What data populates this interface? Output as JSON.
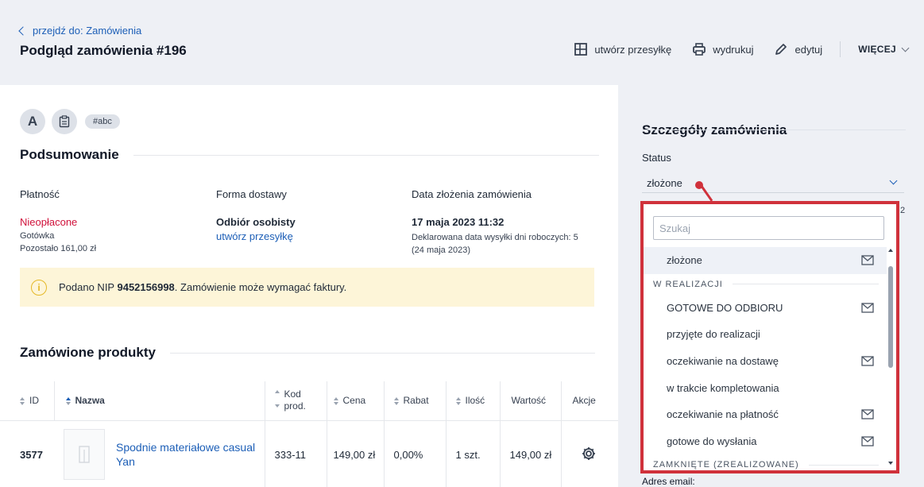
{
  "header": {
    "back_link": "przejdź do: Zamówienia",
    "title": "Podgląd zamówienia #196",
    "actions": {
      "shipment": "utwórz przesyłkę",
      "print": "wydrukuj",
      "edit": "edytuj",
      "more": "WIĘCEJ"
    }
  },
  "chips": {
    "avatar_letter": "A",
    "tag": "#abc"
  },
  "summary": {
    "heading": "Podsumowanie",
    "payment": {
      "label": "Płatność",
      "status": "Nieopłacone",
      "method": "Gotówka",
      "remaining": "Pozostało 161,00 zł"
    },
    "delivery": {
      "label": "Forma dostawy",
      "method": "Odbiór osobisty",
      "link": "utwórz przesyłkę"
    },
    "date": {
      "label": "Data złożenia zamówienia",
      "value": "17 maja 2023 11:32",
      "note_line1": "Deklarowana data wysyłki dni roboczych: 5",
      "note_line2": "(24 maja 2023)"
    },
    "alert": {
      "prefix": "Podano NIP ",
      "nip": "9452156998",
      "suffix": ". Zamówienie może wymagać faktury."
    }
  },
  "products": {
    "heading": "Zamówione produkty",
    "columns": {
      "id": "ID",
      "name": "Nazwa",
      "code_1": "Kod",
      "code_2": "prod.",
      "price": "Cena",
      "discount": "Rabat",
      "qty": "Ilość",
      "value": "Wartość",
      "actions": "Akcje"
    },
    "rows": [
      {
        "id": "3577",
        "name_line1": "Spodnie materiałowe casual",
        "name_line2": "Yan",
        "code": "333-11",
        "price": "149,00 zł",
        "discount": "0,00%",
        "qty": "1 szt.",
        "value": "149,00 zł"
      }
    ]
  },
  "sidebar": {
    "heading": "Szczegóły zamówienia",
    "status_label": "Status",
    "status_value": "złożone",
    "partial_number": "2",
    "email_label": "Adres email:"
  },
  "dropdown": {
    "search_placeholder": "Szukaj",
    "options": [
      {
        "label": "złożone",
        "mail": true,
        "selected": true
      },
      {
        "group": "W REALIZACJI"
      },
      {
        "label": "GOTOWE DO ODBIORU",
        "mail": true
      },
      {
        "label": "przyjęte do realizacji",
        "mail": false
      },
      {
        "label": "oczekiwanie na dostawę",
        "mail": true
      },
      {
        "label": "w trakcie kompletowania",
        "mail": false
      },
      {
        "label": "oczekiwanie na płatność",
        "mail": true
      },
      {
        "label": "gotowe do wysłania",
        "mail": true
      },
      {
        "group": "ZAMKNIĘTE (ZREALIZOWANE)"
      }
    ]
  },
  "colors": {
    "accent": "#1d5fb7",
    "danger": "#d0103a",
    "highlight_border": "#d0313b",
    "alert_bg": "#fdf5d8"
  }
}
